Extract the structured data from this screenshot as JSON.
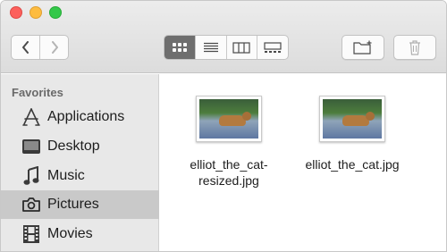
{
  "window": {
    "traffic_lights": {
      "close": "#fc605c",
      "minimize": "#fdbc40",
      "zoom": "#34c84a"
    }
  },
  "toolbar": {
    "nav": {
      "back_icon": "chevron-left-icon",
      "forward_icon": "chevron-right-icon"
    },
    "view_modes": [
      {
        "name": "icon-view",
        "icon": "grid-icon",
        "active": true
      },
      {
        "name": "list-view",
        "icon": "list-icon",
        "active": false
      },
      {
        "name": "column-view",
        "icon": "columns-icon",
        "active": false
      },
      {
        "name": "gallery-view",
        "icon": "gallery-icon",
        "active": false
      }
    ],
    "new_folder_icon": "new-folder-icon",
    "trash_icon": "trash-icon"
  },
  "sidebar": {
    "heading": "Favorites",
    "items": [
      {
        "label": "Applications",
        "icon": "applications-icon",
        "selected": false
      },
      {
        "label": "Desktop",
        "icon": "desktop-icon",
        "selected": false
      },
      {
        "label": "Music",
        "icon": "music-note-icon",
        "selected": false
      },
      {
        "label": "Pictures",
        "icon": "camera-icon",
        "selected": true
      },
      {
        "label": "Movies",
        "icon": "film-icon",
        "selected": false
      }
    ]
  },
  "files": [
    {
      "name": "elliot_the_cat-resized.jpg",
      "icon": "image-thumbnail-icon"
    },
    {
      "name": "elliot_the_cat.jpg",
      "icon": "image-thumbnail-icon"
    }
  ]
}
